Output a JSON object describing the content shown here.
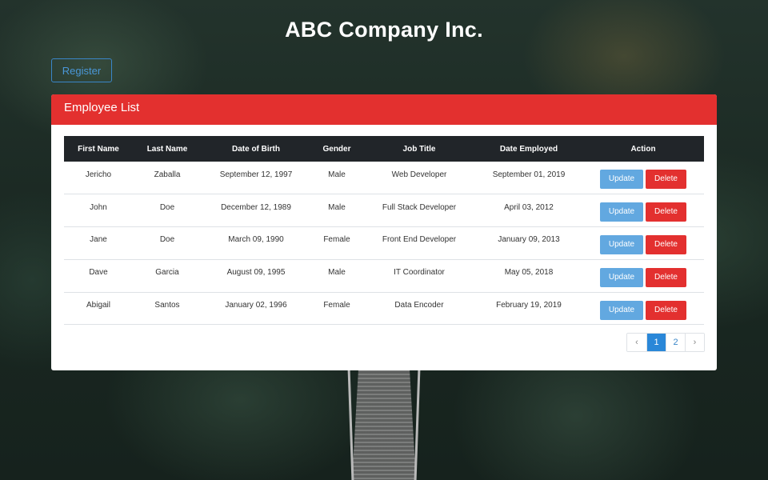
{
  "header": {
    "title": "ABC Company Inc."
  },
  "toolbar": {
    "register_label": "Register"
  },
  "card": {
    "title": "Employee List"
  },
  "table": {
    "columns": [
      "First Name",
      "Last Name",
      "Date of Birth",
      "Gender",
      "Job Title",
      "Date Employed",
      "Action"
    ],
    "rows": [
      [
        "Jericho",
        "Zaballa",
        "September 12, 1997",
        "Male",
        "Web Developer",
        "September 01, 2019"
      ],
      [
        "John",
        "Doe",
        "December 12, 1989",
        "Male",
        "Full Stack Developer",
        "April 03, 2012"
      ],
      [
        "Jane",
        "Doe",
        "March 09, 1990",
        "Female",
        "Front End Developer",
        "January 09, 2013"
      ],
      [
        "Dave",
        "Garcia",
        "August 09, 1995",
        "Male",
        "IT Coordinator",
        "May 05, 2018"
      ],
      [
        "Abigail",
        "Santos",
        "January 02, 1996",
        "Female",
        "Data Encoder",
        "February 19, 2019"
      ]
    ],
    "update_label": "Update",
    "delete_label": "Delete"
  },
  "pagination": {
    "prev": "‹",
    "pages": [
      "1",
      "2"
    ],
    "active_page": "1",
    "next": "›"
  },
  "colors": {
    "header_red": "#e3302f",
    "update_blue": "#62a8e0",
    "table_head": "#212529",
    "active_page": "#2a87d8"
  }
}
